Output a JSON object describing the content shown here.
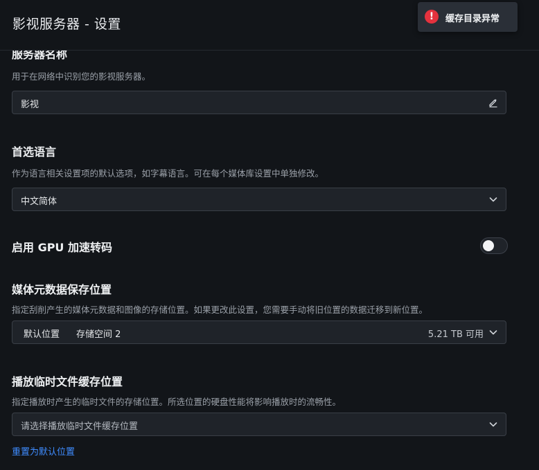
{
  "header": {
    "title": "影视服务器 - 设置"
  },
  "toast": {
    "message": "缓存目录异常",
    "icon": "error-icon",
    "color": "#e5323e"
  },
  "server_name": {
    "title": "服务器名称",
    "description": "用于在网络中识别您的影视服务器。",
    "value": "影视"
  },
  "language": {
    "title": "首选语言",
    "description": "作为语言相关设置项的默认选项，如字幕语言。可在每个媒体库设置中单独修改。",
    "selected": "中文简体"
  },
  "gpu": {
    "title": "启用 GPU 加速转码",
    "enabled": false
  },
  "metadata_location": {
    "title": "媒体元数据保存位置",
    "description": "指定刮削产生的媒体元数据和图像的存储位置。如果更改此设置，您需要手动将旧位置的数据迁移到新位置。",
    "tag": "默认位置",
    "storage": "存储空间 2",
    "available": "5.21 TB 可用"
  },
  "cache_location": {
    "title": "播放临时文件缓存位置",
    "description": "指定播放时产生的临时文件的存储位置。所选位置的硬盘性能将影响播放时的流畅性。",
    "placeholder": "请选择播放临时文件缓存位置",
    "reset_link": "重置为默认位置"
  },
  "colors": {
    "background": "#121519",
    "field": "#1f2329",
    "accent": "#3f8cff",
    "error": "#e5323e"
  }
}
